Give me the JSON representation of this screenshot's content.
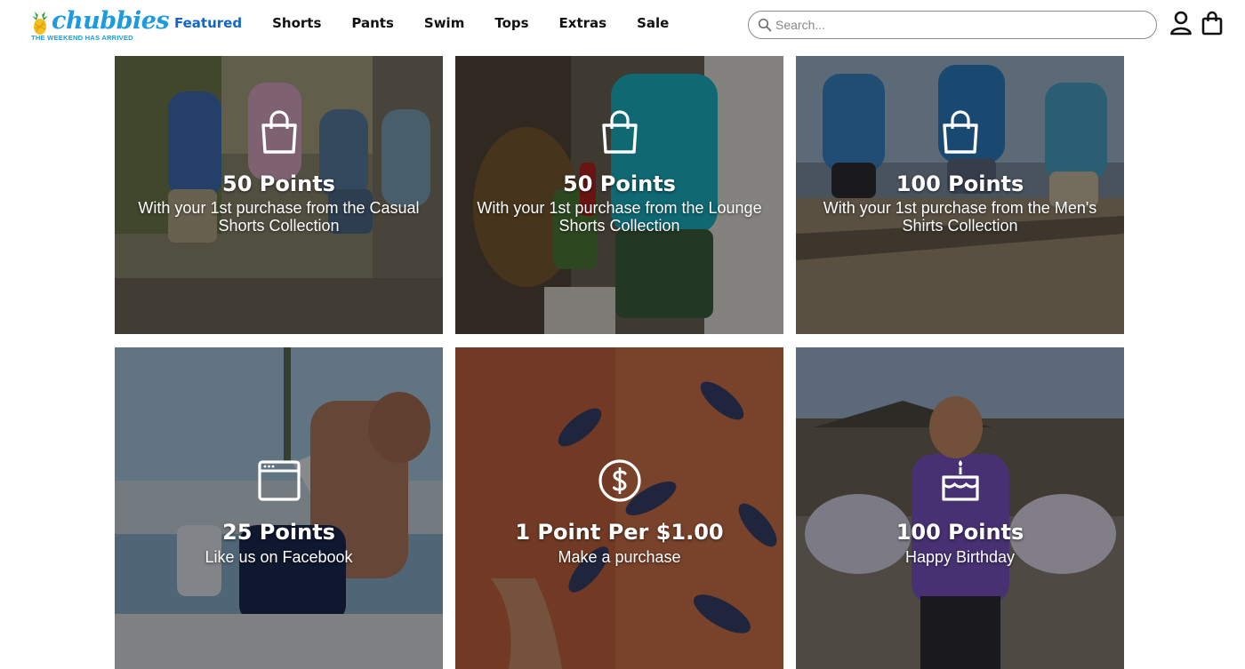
{
  "brand": {
    "name": "chubbies",
    "tagline": "THE WEEKEND HAS ARRIVED",
    "color": "#1e9be0"
  },
  "nav": {
    "active_color": "#1565c8",
    "items": [
      {
        "label": "Featured",
        "active": true
      },
      {
        "label": "Shorts",
        "active": false
      },
      {
        "label": "Pants",
        "active": false
      },
      {
        "label": "Swim",
        "active": false
      },
      {
        "label": "Tops",
        "active": false
      },
      {
        "label": "Extras",
        "active": false
      },
      {
        "label": "Sale",
        "active": false
      }
    ]
  },
  "search": {
    "placeholder": "Search...",
    "value": "",
    "icon": "search-icon"
  },
  "header_icons": {
    "account": "user-icon",
    "cart": "shopping-bag-icon"
  },
  "rewards": [
    {
      "icon": "shopping-bag-icon",
      "title": "50 Points",
      "desc": "With your 1st purchase from the Casual Shorts Collection"
    },
    {
      "icon": "shopping-bag-icon",
      "title": "50 Points",
      "desc": "With your 1st purchase from the Lounge Shorts Collection"
    },
    {
      "icon": "shopping-bag-icon",
      "title": "100 Points",
      "desc": "With your 1st purchase from the Men's Shirts Collection"
    },
    {
      "icon": "browser-window-icon",
      "title": "25 Points",
      "desc": "Like us on Facebook"
    },
    {
      "icon": "dollar-coin-icon",
      "title": "1 Point Per $1.00",
      "desc": "Make a purchase"
    },
    {
      "icon": "birthday-cake-icon",
      "title": "100 Points",
      "desc": "Happy Birthday"
    }
  ]
}
